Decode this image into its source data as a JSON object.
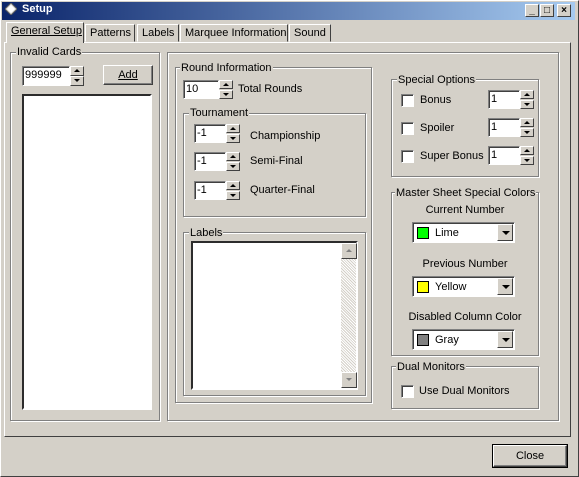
{
  "window": {
    "title": "Setup"
  },
  "tabs": [
    {
      "label": "General Setup",
      "active": true
    },
    {
      "label": "Patterns",
      "active": false
    },
    {
      "label": "Labels",
      "active": false
    },
    {
      "label": "Marquee Information",
      "active": false
    },
    {
      "label": "Sound",
      "active": false
    }
  ],
  "invalid_cards": {
    "legend": "Invalid Cards",
    "value": "999999",
    "add_label": "Add"
  },
  "round_info": {
    "legend": "Round Information",
    "total_rounds_value": "10",
    "total_rounds_label": "Total Rounds",
    "tournament": {
      "legend": "Tournament",
      "championship_value": "-1",
      "championship_label": "Championship",
      "semi_value": "-1",
      "semi_label": "Semi-Final",
      "quarter_value": "-1",
      "quarter_label": "Quarter-Final"
    },
    "labels_legend": "Labels"
  },
  "special_options": {
    "legend": "Special Options",
    "bonus_label": "Bonus",
    "bonus_value": "1",
    "spoiler_label": "Spoiler",
    "spoiler_value": "1",
    "super_bonus_label": "Super Bonus",
    "super_bonus_value": "1"
  },
  "colors": {
    "legend": "Master Sheet Special Colors",
    "current_label": "Current Number",
    "current_value": "Lime",
    "current_swatch": "#00ff00",
    "previous_label": "Previous Number",
    "previous_value": "Yellow",
    "previous_swatch": "#ffff00",
    "disabled_label": "Disabled Column Color",
    "disabled_value": "Gray",
    "disabled_swatch": "#808080"
  },
  "dual_monitors": {
    "legend": "Dual Monitors",
    "checkbox_label": "Use Dual Monitors"
  },
  "footer": {
    "close_label": "Close"
  }
}
